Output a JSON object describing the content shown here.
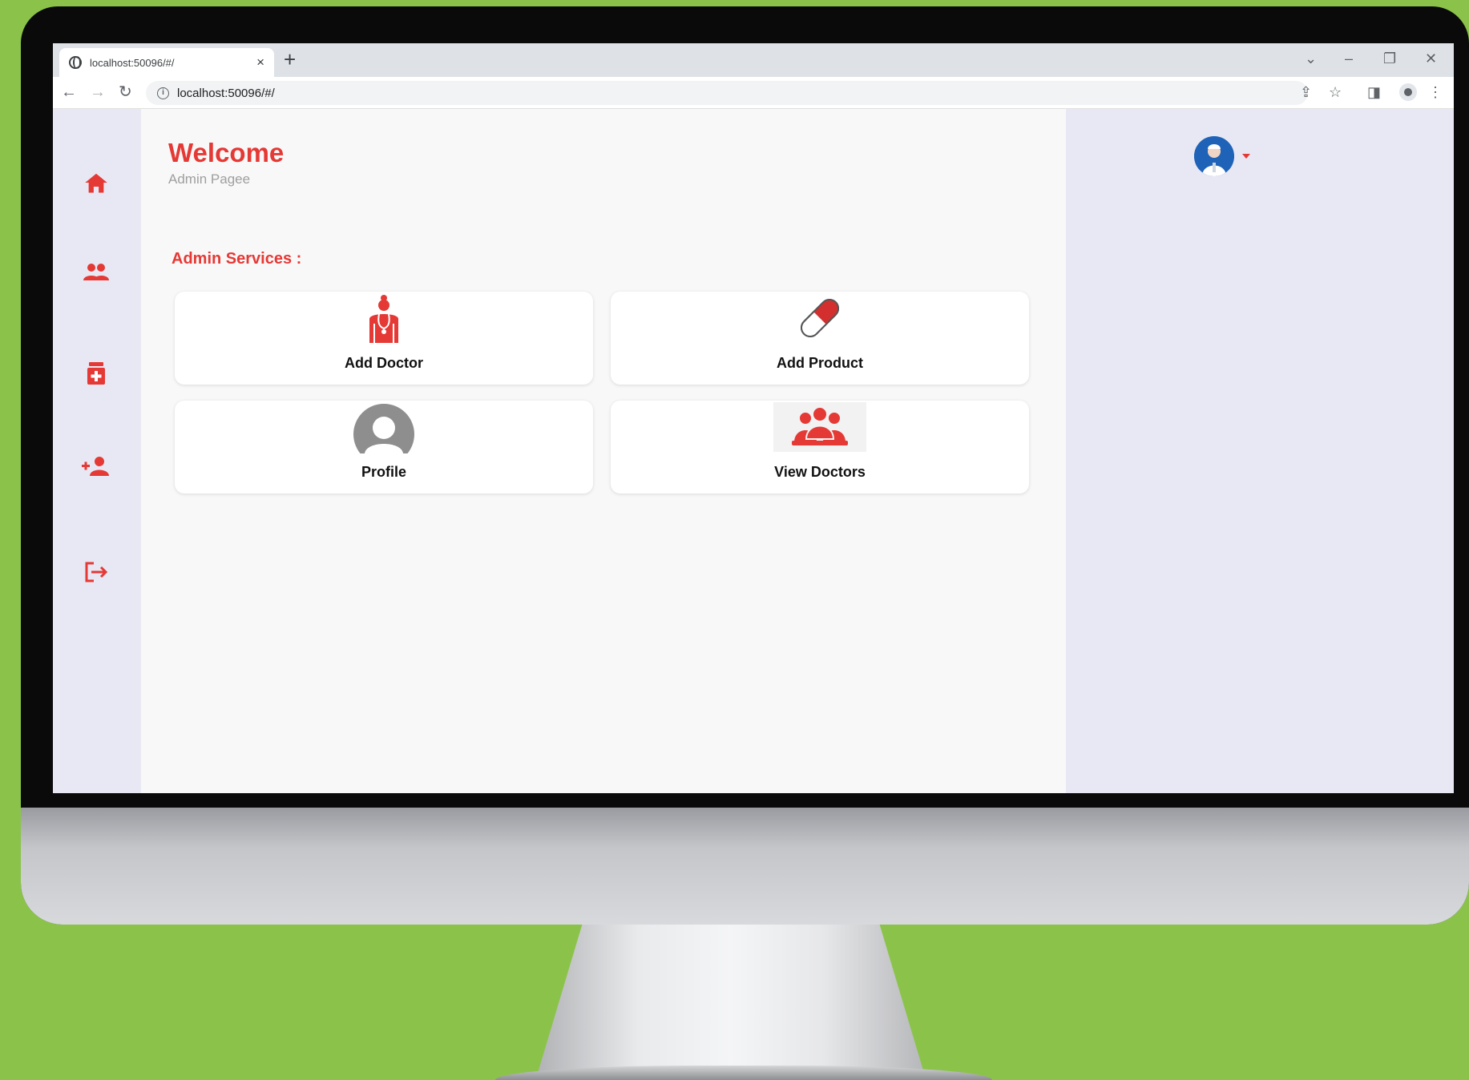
{
  "browser": {
    "tab_title": "localhost:50096/#/",
    "tab_close": "×",
    "new_tab": "+",
    "url": "localhost:50096/#/",
    "info_glyph": "i"
  },
  "app": {
    "title": "Welcome",
    "subtitle": "Admin Pagee",
    "section_title": "Admin Services :",
    "accent_color": "#e53935",
    "cards": [
      {
        "label": "Add Doctor",
        "icon": "doctor-icon"
      },
      {
        "label": "Add Product",
        "icon": "capsule-icon"
      },
      {
        "label": "Profile",
        "icon": "profile-avatar-icon"
      },
      {
        "label": "View Doctors",
        "icon": "group-icon"
      }
    ],
    "sidebar_icons": [
      "home-icon",
      "people-icon",
      "medicine-icon",
      "add-person-icon",
      "logout-icon"
    ]
  }
}
